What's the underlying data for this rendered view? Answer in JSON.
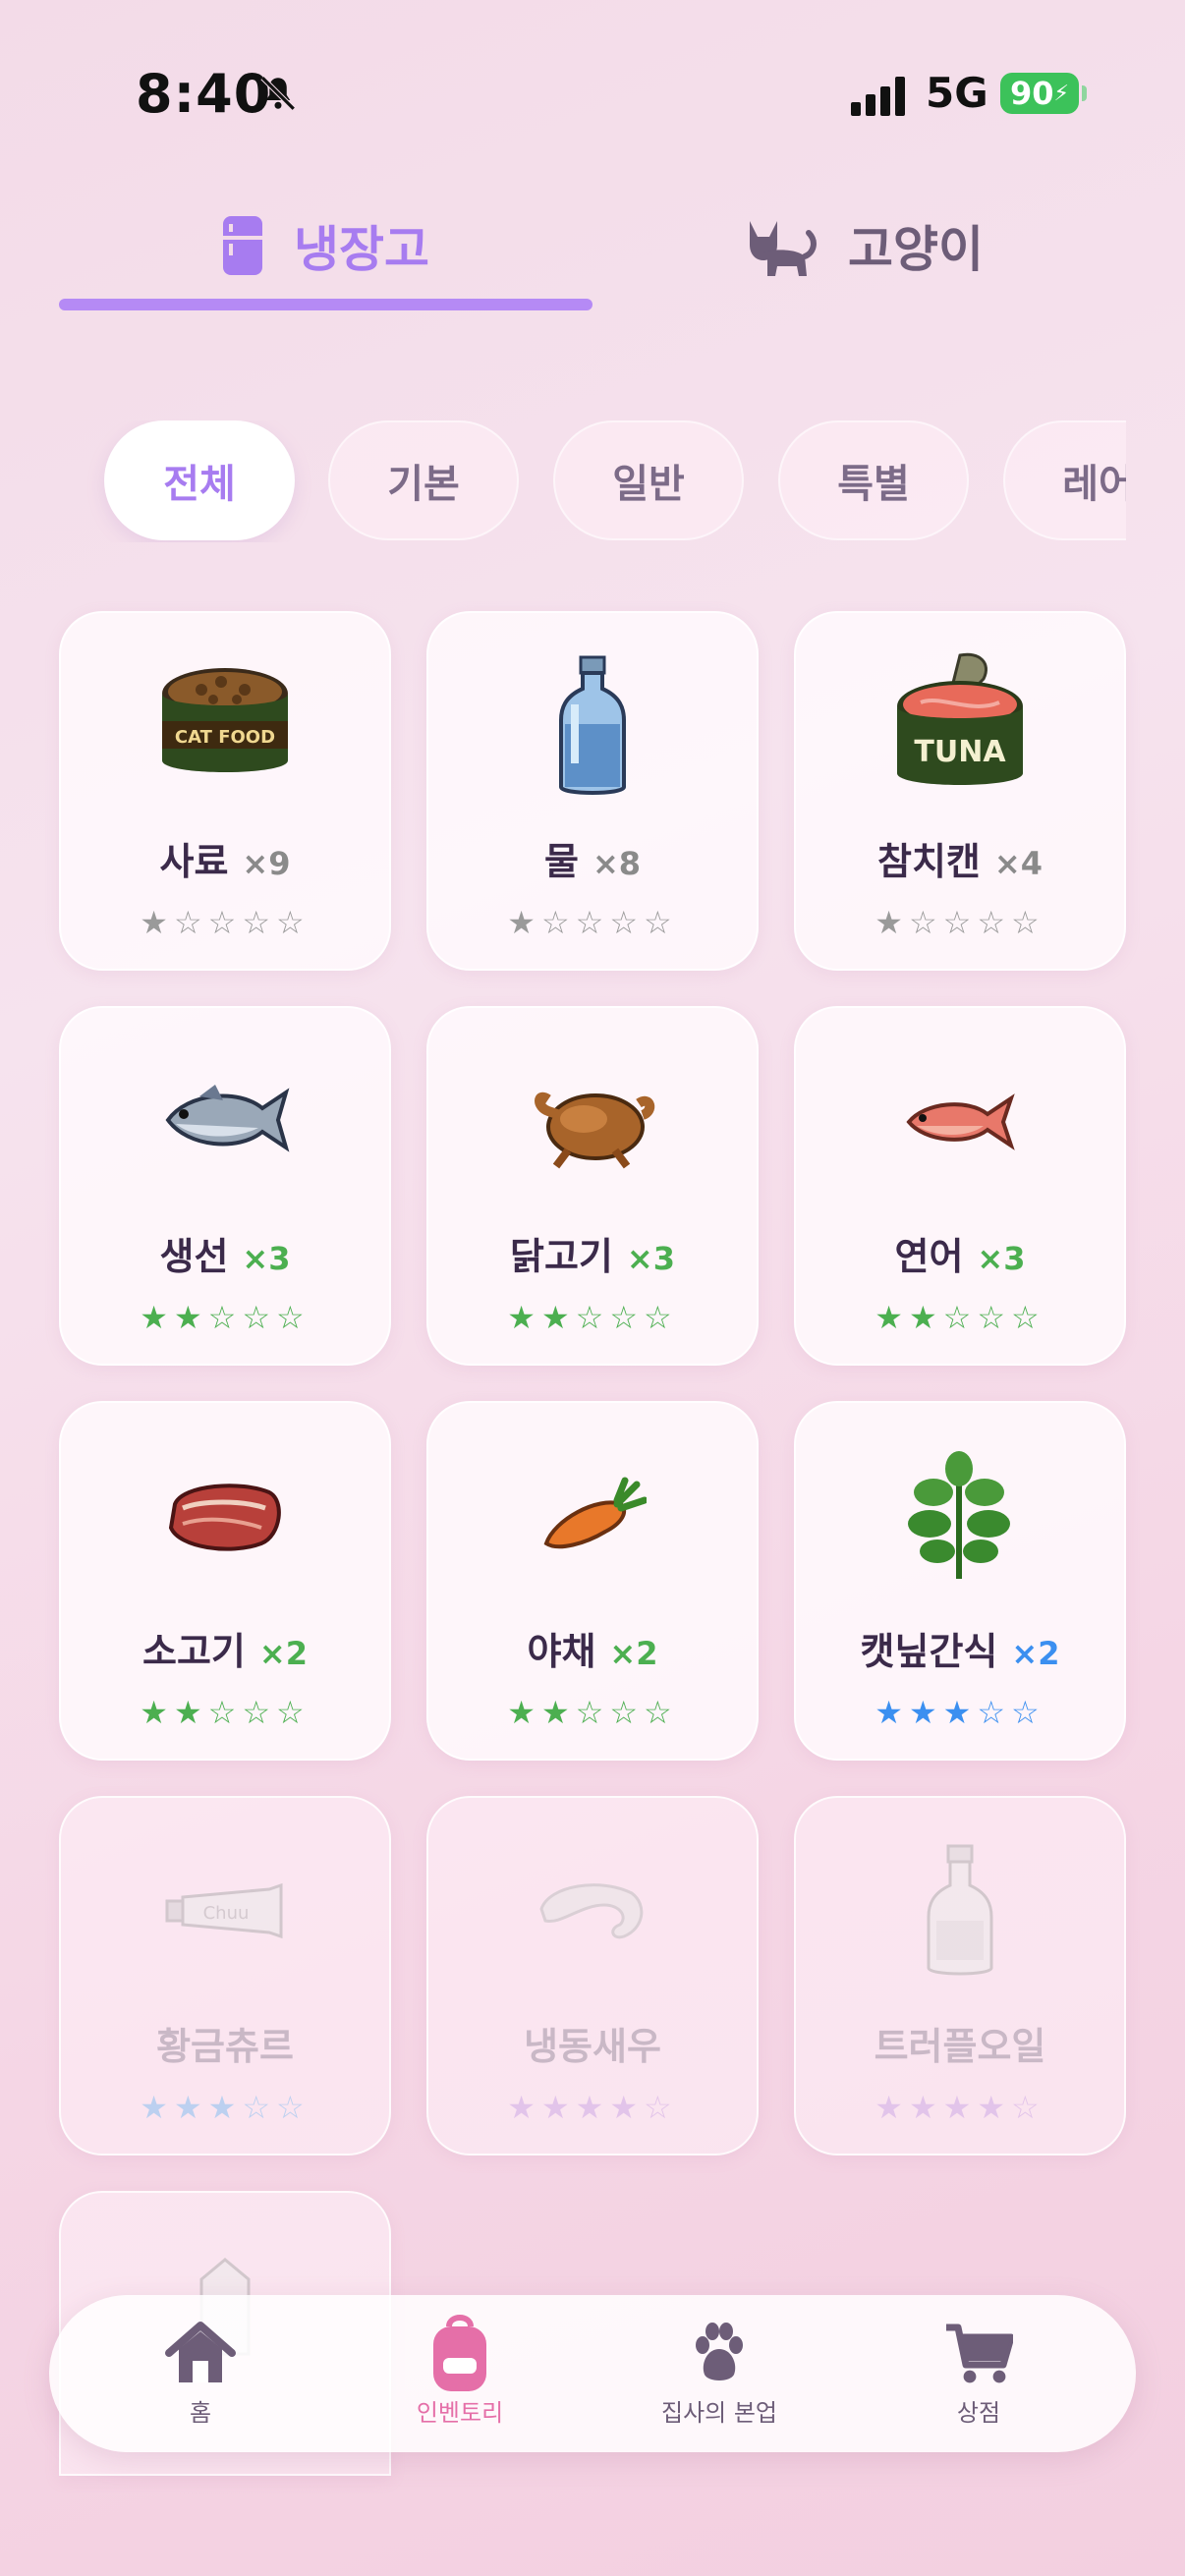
{
  "status": {
    "time": "8:40",
    "network": "5G",
    "battery": "90"
  },
  "tabs": [
    {
      "label": "냉장고",
      "icon": "fridge-icon",
      "active": true
    },
    {
      "label": "고양이",
      "icon": "cat-icon",
      "active": false
    }
  ],
  "filters": [
    "전체",
    "기본",
    "일반",
    "특별",
    "레어"
  ],
  "items": [
    {
      "name": "사료",
      "count": "×9",
      "stars": "★☆☆☆☆",
      "star_color": "#9a9a9a",
      "count_color": "#8a8a8a",
      "icon": "cat-food-can-icon",
      "locked": false
    },
    {
      "name": "물",
      "count": "×8",
      "stars": "★☆☆☆☆",
      "star_color": "#9a9a9a",
      "count_color": "#8a8a8a",
      "icon": "water-bottle-icon",
      "locked": false
    },
    {
      "name": "참치캔",
      "count": "×4",
      "stars": "★☆☆☆☆",
      "star_color": "#9a9a9a",
      "count_color": "#8a8a8a",
      "icon": "tuna-can-icon",
      "locked": false
    },
    {
      "name": "생선",
      "count": "×3",
      "stars": "★★☆☆☆",
      "star_color": "#4caf50",
      "count_color": "#4caf50",
      "icon": "fish-icon",
      "locked": false
    },
    {
      "name": "닭고기",
      "count": "×3",
      "stars": "★★☆☆☆",
      "star_color": "#4caf50",
      "count_color": "#4caf50",
      "icon": "roast-chicken-icon",
      "locked": false
    },
    {
      "name": "연어",
      "count": "×3",
      "stars": "★★☆☆☆",
      "star_color": "#4caf50",
      "count_color": "#4caf50",
      "icon": "salmon-icon",
      "locked": false
    },
    {
      "name": "소고기",
      "count": "×2",
      "stars": "★★☆☆☆",
      "star_color": "#4caf50",
      "count_color": "#4caf50",
      "icon": "steak-icon",
      "locked": false
    },
    {
      "name": "야채",
      "count": "×2",
      "stars": "★★☆☆☆",
      "star_color": "#4caf50",
      "count_color": "#4caf50",
      "icon": "carrot-icon",
      "locked": false
    },
    {
      "name": "캣닢간식",
      "count": "×2",
      "stars": "★★★☆☆",
      "star_color": "#3b8ff0",
      "count_color": "#3b8ff0",
      "icon": "catnip-icon",
      "locked": false
    },
    {
      "name": "황금츄르",
      "count": "",
      "stars": "★★★☆☆",
      "star_color": "#bcd0f0",
      "count_color": "#bcd0f0",
      "icon": "churu-tube-icon",
      "locked": true
    },
    {
      "name": "냉동새우",
      "count": "",
      "stars": "★★★★☆",
      "star_color": "#e2c4ea",
      "count_color": "#e2c4ea",
      "icon": "shrimp-icon",
      "locked": true
    },
    {
      "name": "트러플오일",
      "count": "",
      "stars": "★★★★☆",
      "star_color": "#e2c4ea",
      "count_color": "#e2c4ea",
      "icon": "oil-bottle-icon",
      "locked": true
    },
    {
      "name": "",
      "count": "",
      "stars": "",
      "star_color": "#e2c4ea",
      "count_color": "#e2c4ea",
      "icon": "milk-carton-icon",
      "locked": true
    }
  ],
  "nav": [
    {
      "label": "홈",
      "icon": "home-icon",
      "active": false
    },
    {
      "label": "인벤토리",
      "icon": "backpack-icon",
      "active": true
    },
    {
      "label": "집사의 본업",
      "icon": "paw-icon",
      "active": false
    },
    {
      "label": "상점",
      "icon": "cart-icon",
      "active": false
    }
  ],
  "colors": {
    "accent": "#a77cf0",
    "nav_active": "#e56fa8"
  }
}
